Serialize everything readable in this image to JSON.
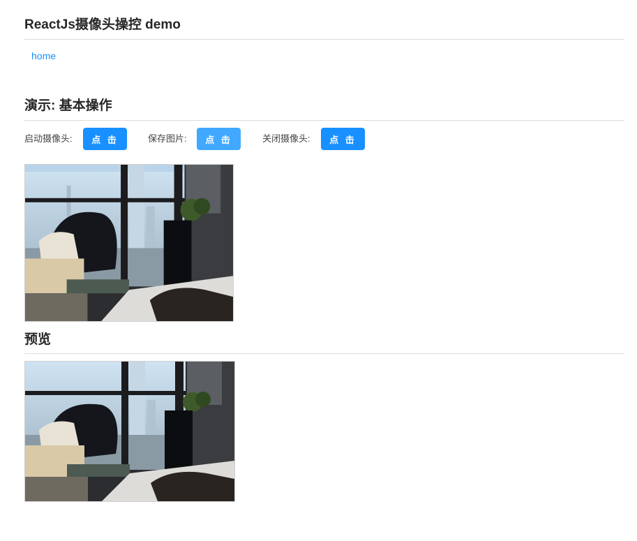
{
  "header": {
    "title": "ReactJs摄像头操控 demo"
  },
  "nav": {
    "home_label": "home"
  },
  "demo": {
    "title": "演示: 基本操作",
    "controls": [
      {
        "label": "启动摄像头:",
        "button": "点 击"
      },
      {
        "label": "保存图片:",
        "button": "点 击"
      },
      {
        "label": "关闭摄像头:",
        "button": "点 击"
      }
    ]
  },
  "preview": {
    "title": "预览"
  },
  "colors": {
    "accent": "#1890ff",
    "accent_light": "#40a9ff",
    "rule": "#dcdcdc"
  }
}
